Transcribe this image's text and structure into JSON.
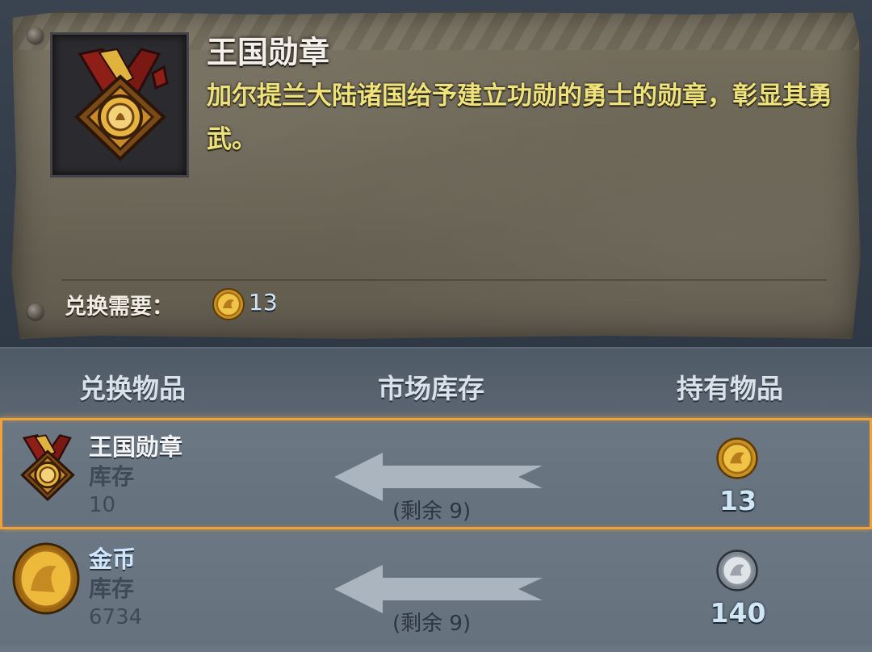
{
  "detail": {
    "title": "王国勋章",
    "description": "加尔提兰大陆诸国给予建立功勋的勇士的勋章，彰显其勇武。",
    "requirement_label": "兑换需要：",
    "requirement_value": "13",
    "requirement_icon": "gold-medal-coin-icon"
  },
  "table": {
    "headers": {
      "exchange_item": "兑换物品",
      "market_stock": "市场库存",
      "held_item": "持有物品"
    },
    "rows": [
      {
        "name": "王国勋章",
        "icon": "kingdom-medal-icon",
        "stock_label": "库存",
        "stock_value": "10",
        "remaining": "(剩余 9)",
        "held_icon": "gold-medal-coin-icon",
        "held_value": "13",
        "selected": true
      },
      {
        "name": "金币",
        "icon": "gold-coin-icon",
        "stock_label": "库存",
        "stock_value": "6734",
        "remaining": "(剩余 9)",
        "held_icon": "silver-coin-icon",
        "held_value": "140",
        "selected": false
      }
    ]
  },
  "colors": {
    "selection_border": "#f0a238",
    "description_text": "#f0e27a",
    "value_text": "#cfe6f6"
  }
}
